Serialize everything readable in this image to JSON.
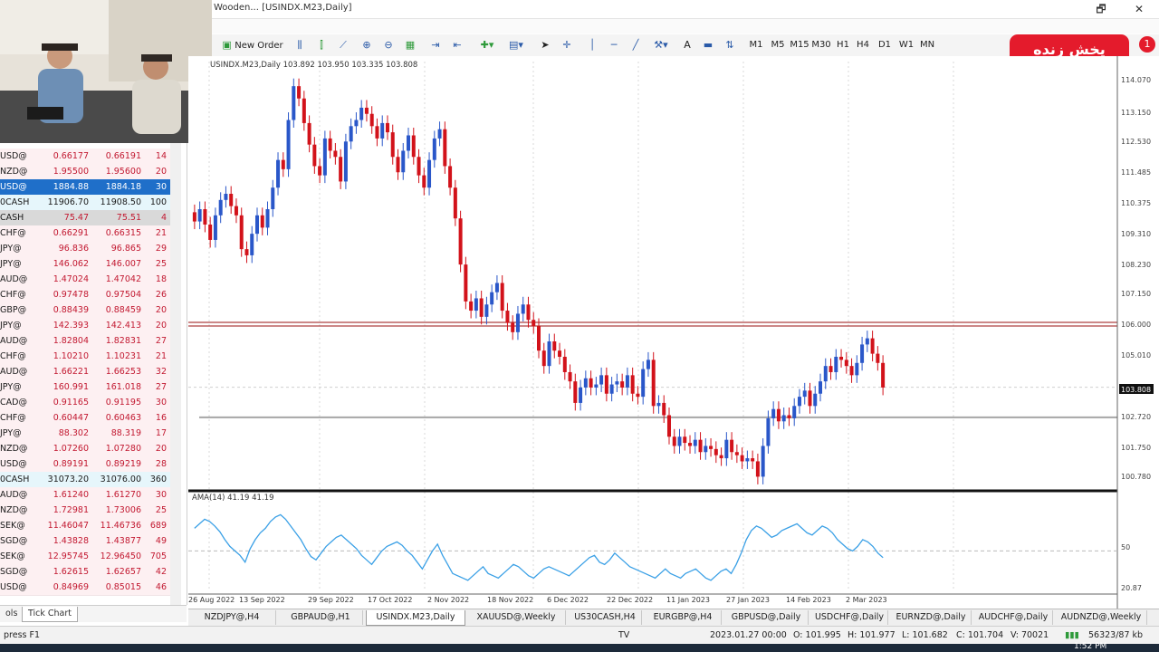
{
  "window": {
    "title": "Wooden... [USINDX.M23,Daily]",
    "minimize": "🗗",
    "close": "✕"
  },
  "toolbar": {
    "new_order": "New Order",
    "timeframes": [
      "M1",
      "M5",
      "M15",
      "M30",
      "H1",
      "H4",
      "D1",
      "W1",
      "MN"
    ]
  },
  "live_badge": {
    "text": "پخش زنده",
    "count": "1",
    "color": "#e41b2c"
  },
  "market_watch": {
    "rows": [
      {
        "sym": "USD@",
        "bid": "0.66177",
        "ask": "0.66191",
        "spr": "14",
        "style": "normal"
      },
      {
        "sym": "NZD@",
        "bid": "1.95500",
        "ask": "1.95600",
        "spr": "20",
        "style": "normal"
      },
      {
        "sym": "USD@",
        "bid": "1884.88",
        "ask": "1884.18",
        "spr": "30",
        "style": "selected"
      },
      {
        "sym": "0CASH",
        "bid": "11906.70",
        "ask": "11908.50",
        "spr": "100",
        "style": "cash"
      },
      {
        "sym": "CASH",
        "bid": "75.47",
        "ask": "75.51",
        "spr": "4",
        "style": "gray"
      },
      {
        "sym": "CHF@",
        "bid": "0.66291",
        "ask": "0.66315",
        "spr": "21",
        "style": "normal"
      },
      {
        "sym": "JPY@",
        "bid": "96.836",
        "ask": "96.865",
        "spr": "29",
        "style": "normal"
      },
      {
        "sym": "JPY@",
        "bid": "146.062",
        "ask": "146.007",
        "spr": "25",
        "style": "normal"
      },
      {
        "sym": "AUD@",
        "bid": "1.47024",
        "ask": "1.47042",
        "spr": "18",
        "style": "normal"
      },
      {
        "sym": "CHF@",
        "bid": "0.97478",
        "ask": "0.97504",
        "spr": "26",
        "style": "normal"
      },
      {
        "sym": "GBP@",
        "bid": "0.88439",
        "ask": "0.88459",
        "spr": "20",
        "style": "normal"
      },
      {
        "sym": "JPY@",
        "bid": "142.393",
        "ask": "142.413",
        "spr": "20",
        "style": "normal"
      },
      {
        "sym": "AUD@",
        "bid": "1.82804",
        "ask": "1.82831",
        "spr": "27",
        "style": "normal"
      },
      {
        "sym": "CHF@",
        "bid": "1.10210",
        "ask": "1.10231",
        "spr": "21",
        "style": "normal"
      },
      {
        "sym": "AUD@",
        "bid": "1.66221",
        "ask": "1.66253",
        "spr": "32",
        "style": "normal"
      },
      {
        "sym": "JPY@",
        "bid": "160.991",
        "ask": "161.018",
        "spr": "27",
        "style": "normal"
      },
      {
        "sym": "CAD@",
        "bid": "0.91165",
        "ask": "0.91195",
        "spr": "30",
        "style": "normal"
      },
      {
        "sym": "CHF@",
        "bid": "0.60447",
        "ask": "0.60463",
        "spr": "16",
        "style": "normal"
      },
      {
        "sym": "JPY@",
        "bid": "88.302",
        "ask": "88.319",
        "spr": "17",
        "style": "normal"
      },
      {
        "sym": "NZD@",
        "bid": "1.07260",
        "ask": "1.07280",
        "spr": "20",
        "style": "normal"
      },
      {
        "sym": "USD@",
        "bid": "0.89191",
        "ask": "0.89219",
        "spr": "28",
        "style": "normal"
      },
      {
        "sym": "0CASH",
        "bid": "31073.20",
        "ask": "31076.00",
        "spr": "360",
        "style": "cash"
      },
      {
        "sym": "AUD@",
        "bid": "1.61240",
        "ask": "1.61270",
        "spr": "30",
        "style": "normal"
      },
      {
        "sym": "NZD@",
        "bid": "1.72981",
        "ask": "1.73006",
        "spr": "25",
        "style": "normal"
      },
      {
        "sym": "SEK@",
        "bid": "11.46047",
        "ask": "11.46736",
        "spr": "689",
        "style": "normal"
      },
      {
        "sym": "SGD@",
        "bid": "1.43828",
        "ask": "1.43877",
        "spr": "49",
        "style": "normal"
      },
      {
        "sym": "SEK@",
        "bid": "12.95745",
        "ask": "12.96450",
        "spr": "705",
        "style": "normal"
      },
      {
        "sym": "SGD@",
        "bid": "1.62615",
        "ask": "1.62657",
        "spr": "42",
        "style": "normal"
      },
      {
        "sym": "USD@",
        "bid": "0.84969",
        "ask": "0.85015",
        "spr": "46",
        "style": "normal"
      }
    ],
    "tabs": [
      "ols",
      "Tick Chart"
    ]
  },
  "chart_header": "USINDX.M23,Daily 103.892 103.950 103.335 103.808",
  "indicator_header": "AMA(14) 41.19 41.19",
  "chart_data": [
    {
      "type": "candlestick",
      "title": "USINDX.M23,Daily",
      "x_labels": [
        "26 Aug 2022",
        "13 Sep 2022",
        "29 Sep 2022",
        "17 Oct 2022",
        "2 Nov 2022",
        "18 Nov 2022",
        "6 Dec 2022",
        "22 Dec 2022",
        "11 Jan 2023",
        "27 Jan 2023",
        "14 Feb 2023",
        "2 Mar 2023"
      ],
      "y_ticks": [
        "114.070",
        "113.150",
        "112.530",
        "111.485",
        "110.375",
        "109.310",
        "108.230",
        "107.150",
        "106.000",
        "105.010",
        "103.808",
        "102.720",
        "101.750",
        "100.780"
      ],
      "ylim": [
        100.5,
        114.4
      ],
      "current_price": "103.808",
      "resistance_levels": [
        105.92,
        105.8
      ],
      "support_level": 102.83,
      "closes": [
        109.2,
        109.6,
        109.1,
        108.6,
        109.4,
        109.9,
        110.1,
        109.7,
        109.4,
        108.3,
        108.1,
        108.8,
        109.4,
        109.0,
        109.6,
        110.3,
        111.2,
        110.9,
        112.5,
        113.6,
        113.2,
        112.4,
        111.7,
        111.0,
        110.7,
        111.9,
        111.5,
        111.3,
        110.5,
        111.8,
        112.3,
        112.5,
        112.9,
        112.7,
        112.3,
        111.9,
        112.4,
        112.1,
        111.3,
        110.8,
        111.5,
        112.0,
        111.3,
        110.7,
        110.3,
        111.2,
        111.9,
        112.2,
        111.0,
        110.3,
        109.3,
        107.8,
        106.6,
        106.3,
        106.7,
        106.1,
        106.5,
        106.9,
        107.2,
        106.3,
        105.9,
        105.6,
        106.2,
        106.5,
        106.0,
        105.8,
        105.0,
        104.5,
        105.3,
        105.0,
        104.8,
        104.3,
        104.0,
        103.3,
        103.8,
        104.1,
        103.8,
        103.9,
        104.2,
        103.6,
        103.9,
        104.0,
        103.8,
        104.2,
        103.6,
        103.5,
        104.4,
        104.7,
        103.2,
        103.3,
        102.9,
        102.2,
        101.9,
        102.2,
        102.0,
        101.9,
        102.1,
        101.7,
        101.9,
        101.8,
        101.6,
        101.5,
        102.1,
        101.7,
        101.6,
        101.4,
        101.5,
        101.4,
        100.9,
        101.9,
        102.8,
        103.1,
        102.7,
        102.9,
        102.8,
        103.2,
        103.5,
        103.7,
        103.2,
        103.6,
        104.0,
        104.5,
        104.3,
        104.8,
        104.7,
        104.5,
        104.2,
        104.6,
        105.2,
        105.4,
        104.9,
        104.6,
        103.8
      ]
    },
    {
      "type": "line",
      "title": "AMA(14)",
      "x_labels": [
        "26 Aug 2022",
        "13 Sep 2022",
        "29 Sep 2022",
        "17 Oct 2022",
        "2 Nov 2022",
        "18 Nov 2022",
        "6 Dec 2022",
        "22 Dec 2022",
        "11 Jan 2023",
        "27 Jan 2023",
        "14 Feb 2023",
        "2 Mar 2023"
      ],
      "y_ticks": [
        "50",
        "20.87"
      ],
      "ylim": [
        15,
        100
      ],
      "levels": [
        50
      ],
      "values": [
        70,
        74,
        78,
        76,
        72,
        67,
        60,
        54,
        50,
        46,
        40,
        52,
        60,
        66,
        70,
        76,
        80,
        82,
        78,
        72,
        66,
        60,
        52,
        45,
        42,
        48,
        54,
        58,
        62,
        64,
        60,
        56,
        52,
        46,
        42,
        38,
        44,
        50,
        54,
        56,
        58,
        55,
        50,
        46,
        40,
        34,
        42,
        50,
        56,
        46,
        38,
        30,
        28,
        26,
        24,
        28,
        32,
        36,
        30,
        28,
        26,
        30,
        34,
        38,
        36,
        32,
        28,
        26,
        30,
        34,
        36,
        34,
        32,
        30,
        28,
        32,
        36,
        40,
        44,
        46,
        40,
        38,
        42,
        48,
        44,
        40,
        36,
        34,
        32,
        30,
        28,
        26,
        30,
        34,
        30,
        28,
        26,
        30,
        32,
        34,
        30,
        26,
        24,
        28,
        32,
        34,
        30,
        38,
        48,
        60,
        68,
        72,
        70,
        66,
        62,
        64,
        68,
        70,
        72,
        74,
        70,
        66,
        64,
        68,
        72,
        70,
        66,
        60,
        56,
        52,
        50,
        54,
        60,
        58,
        54,
        48,
        44
      ]
    }
  ],
  "chart_tabs": [
    {
      "label": "NZDJPY@,H4",
      "active": false
    },
    {
      "label": "GBPAUD@,H1",
      "active": false
    },
    {
      "label": "USINDX.M23,Daily",
      "active": true
    },
    {
      "label": "XAUUSD@,Weekly",
      "active": false
    },
    {
      "label": "US30CASH,H4",
      "active": false
    },
    {
      "label": "EURGBP@,H4",
      "active": false
    },
    {
      "label": "GBPUSD@,Daily",
      "active": false
    },
    {
      "label": "USDCHF@,Daily",
      "active": false
    },
    {
      "label": "EURNZD@,Daily",
      "active": false
    },
    {
      "label": "AUDCHF@,Daily",
      "active": false
    },
    {
      "label": "AUDNZD@,Weekly",
      "active": false
    }
  ],
  "status": {
    "help": "press F1",
    "mode": "TV",
    "datetime": "2023.01.27 00:00",
    "open": "O: 101.995",
    "high": "H: 101.977",
    "low": "L: 101.682",
    "close": "C: 101.704",
    "volume": "V: 70021",
    "traffic": "56323/87 kb",
    "clock": "1:52 PM"
  }
}
